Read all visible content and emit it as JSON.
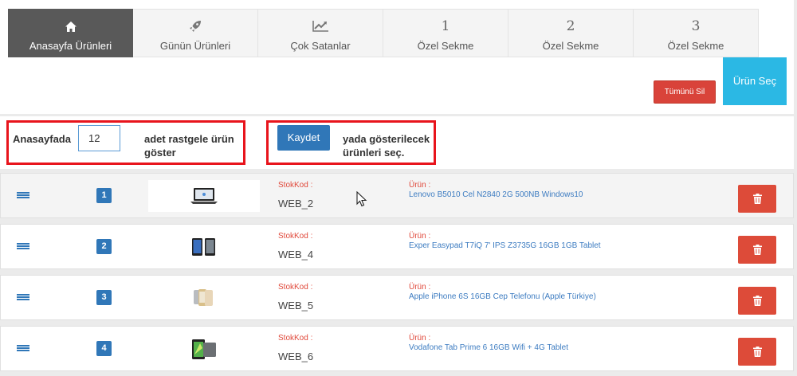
{
  "tabs": [
    {
      "label": "Anasayfa Ürünleri",
      "icon": "home-icon",
      "active": true
    },
    {
      "label": "Günün Ürünleri",
      "icon": "rocket-icon",
      "active": false
    },
    {
      "label": "Çok Satanlar",
      "icon": "line-chart-icon",
      "active": false
    },
    {
      "label": "Özel Sekme",
      "number": "1",
      "active": false
    },
    {
      "label": "Özel Sekme",
      "number": "2",
      "active": false
    },
    {
      "label": "Özel Sekme",
      "number": "3",
      "active": false
    }
  ],
  "actions": {
    "clear_all": "Tümünü Sil",
    "select_products": "Ürün Seç"
  },
  "settings": {
    "prefix": "Anasayfada",
    "count": "12",
    "suffix_line1": "adet rastgele ürün",
    "suffix_line2": "göster",
    "save": "Kaydet",
    "alt_line1": "yada gösterilecek",
    "alt_line2": "ürünleri seç."
  },
  "labels": {
    "stock_code": "StokKod :",
    "product": "Ürün :"
  },
  "products": [
    {
      "index": "1",
      "stock_code": "WEB_2",
      "name": "Lenovo B5010 Cel N2840 2G 500NB Windows10",
      "thumb": "laptop"
    },
    {
      "index": "2",
      "stock_code": "WEB_4",
      "name": "Exper Easypad T7iQ 7' IPS Z3735G 16GB 1GB Tablet",
      "thumb": "tablet-pair"
    },
    {
      "index": "3",
      "stock_code": "WEB_5",
      "name": "Apple iPhone 6S 16GB Cep Telefonu (Apple Türkiye)",
      "thumb": "phone-trio"
    },
    {
      "index": "4",
      "stock_code": "WEB_6",
      "name": "Vodafone Tab Prime 6 16GB Wifi + 4G Tablet",
      "thumb": "tablet-green"
    }
  ],
  "colors": {
    "primary": "#3077b8",
    "danger": "#dd4b39",
    "info": "#2bb8e4",
    "highlight_border": "#e8141c",
    "tab_active": "#595959"
  }
}
